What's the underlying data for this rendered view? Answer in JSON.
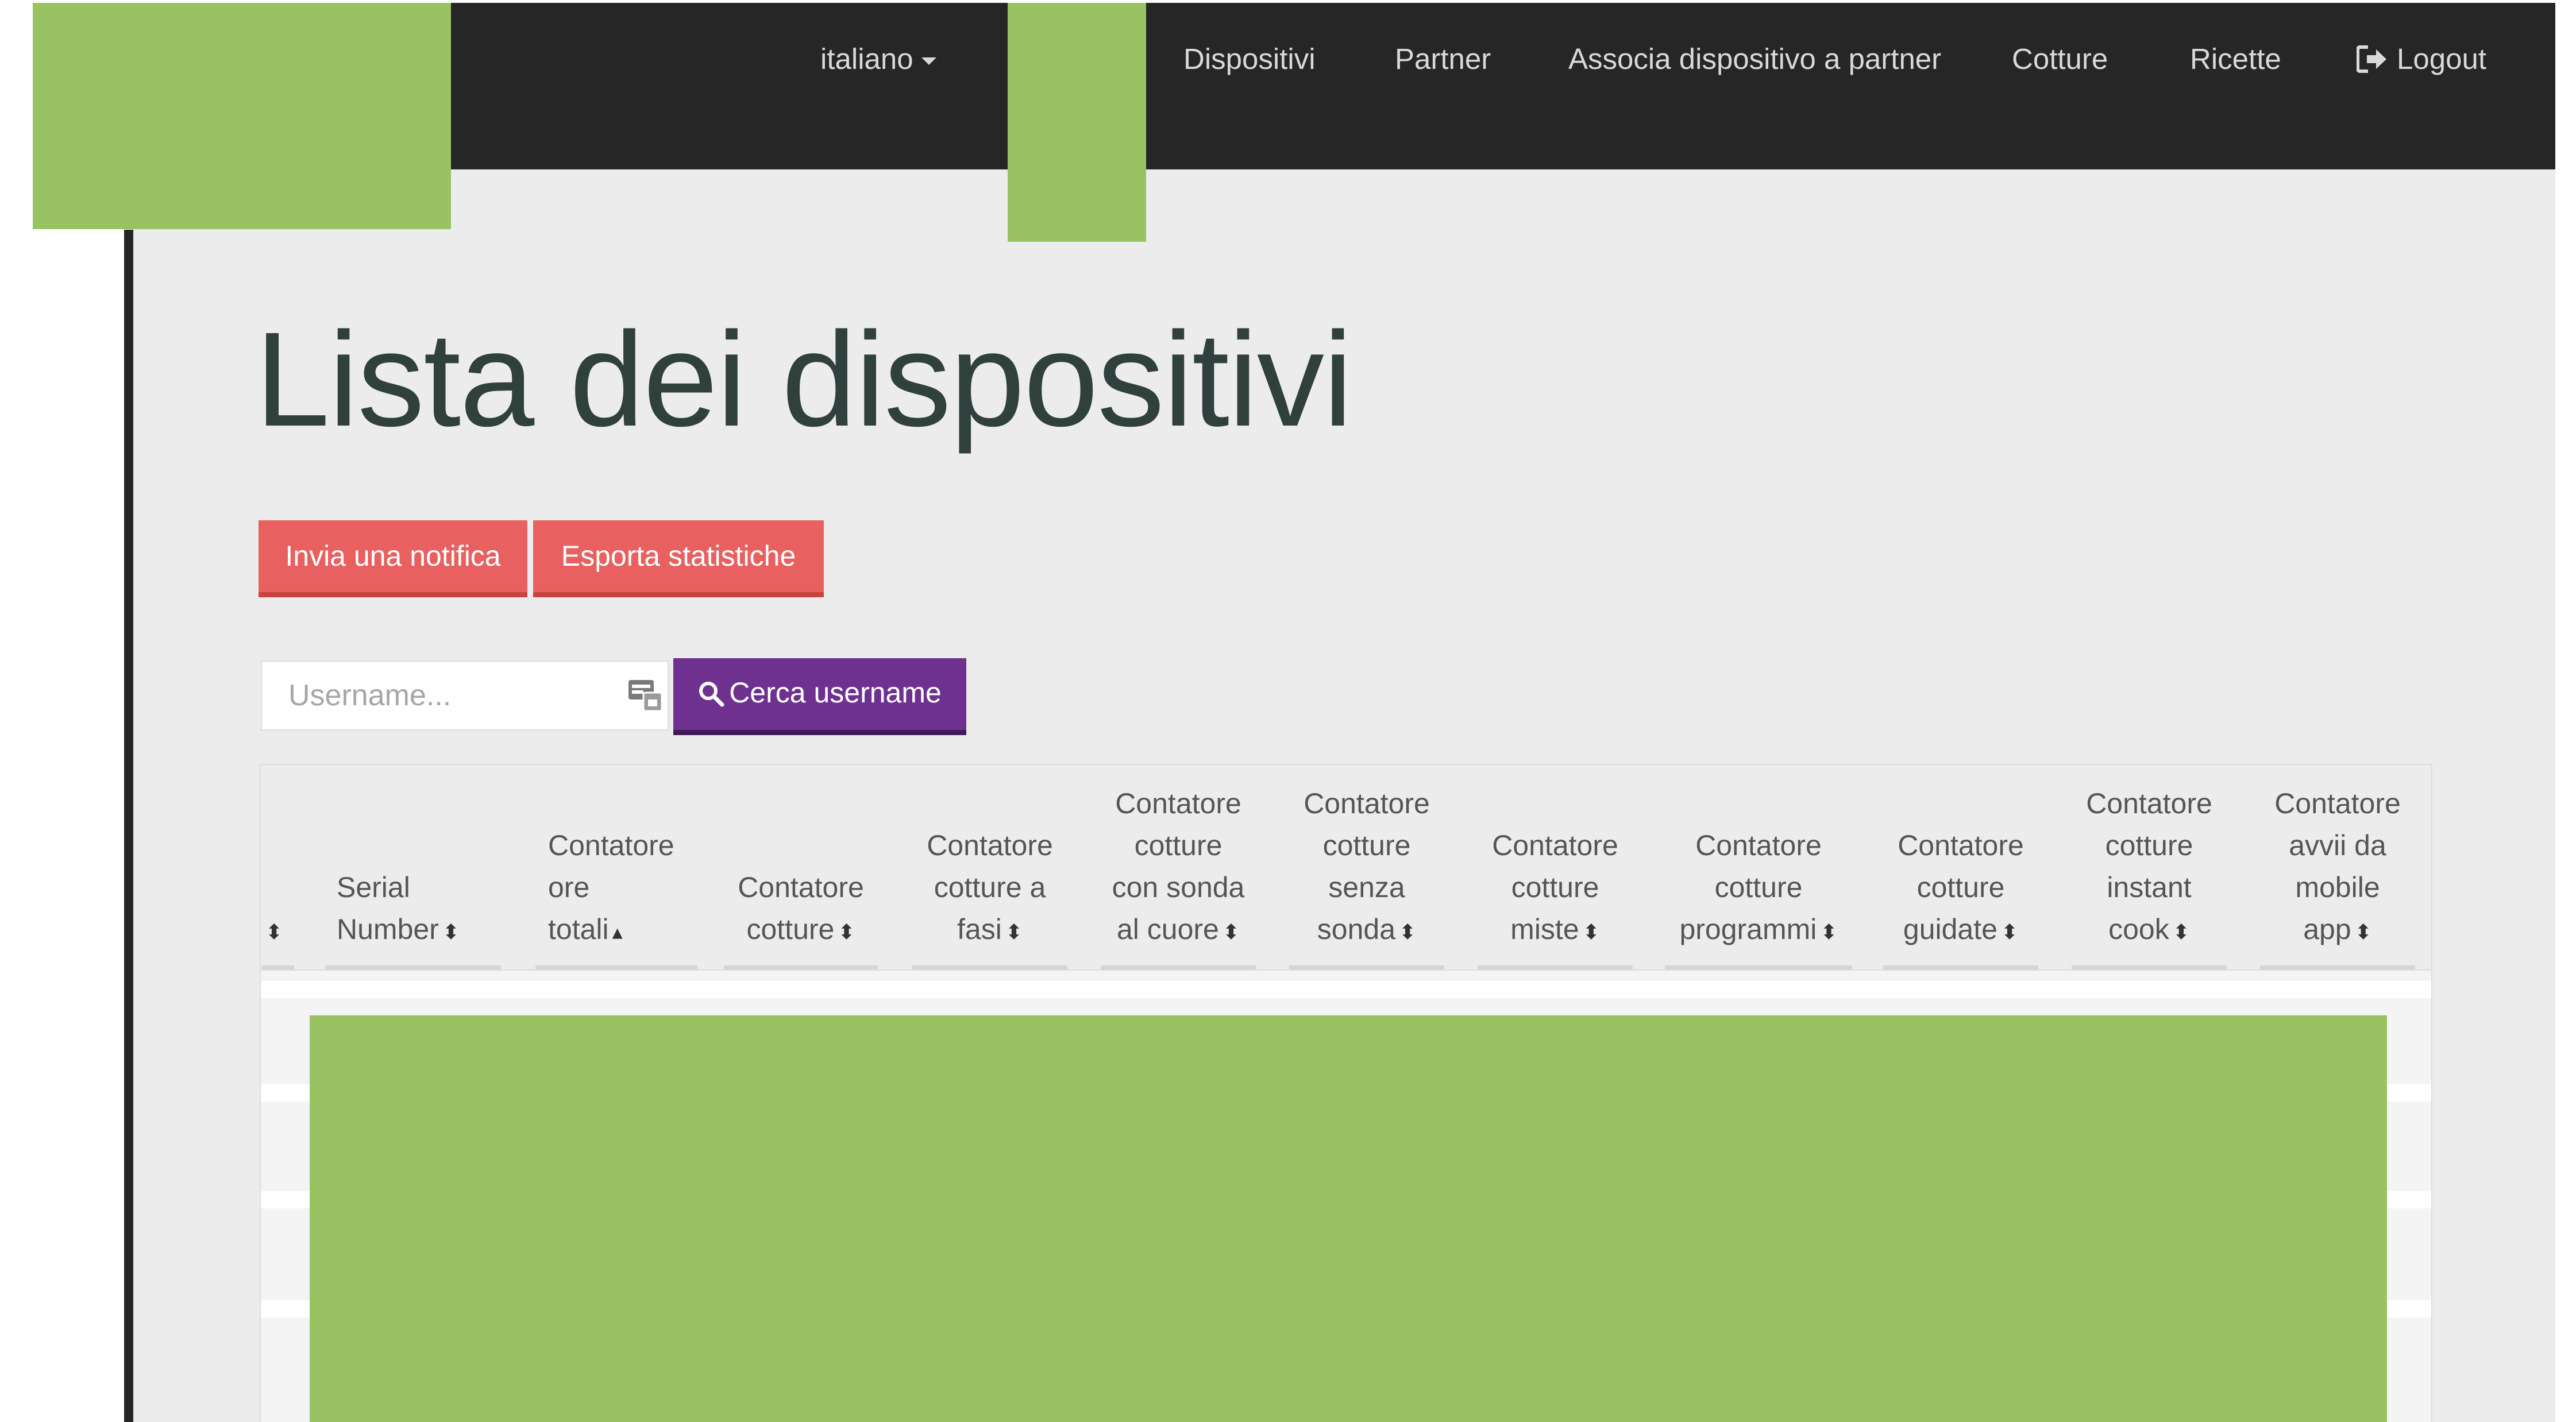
{
  "nav": {
    "language_label": "italiano",
    "items": [
      "Dispositivi",
      "Partner",
      "Associa dispositivo a partner",
      "Cotture",
      "Ricette"
    ],
    "logout_label": "Logout"
  },
  "page": {
    "title": "Lista dei dispositivi"
  },
  "actions": {
    "notify_label": "Invia una notifica",
    "export_label": "Esporta statistiche"
  },
  "search": {
    "placeholder": "Username...",
    "button_label": "Cerca username"
  },
  "table": {
    "columns": [
      "",
      "Serial\nNumber",
      "Contatore\nore\ntotali",
      "Contatore\ncotture",
      "Contatore\ncotture a\nfasi",
      "Contatore\ncotture\ncon sonda\nal cuore",
      "Contatore\ncotture\nsenza\nsonda",
      "Contatore\ncotture\nmiste",
      "Contatore\ncotture\nprogrammi",
      "Contatore\ncotture\nguidate",
      "Contatore\ncotture\ninstant\ncook",
      "Contatore\navvii da\nmobile\napp"
    ],
    "sort_indicators": [
      "⬍",
      "⬍",
      "▴",
      "⬍",
      "⬍",
      "⬍",
      "⬍",
      "⬍",
      "⬍",
      "⬍",
      "⬍",
      "⬍"
    ]
  },
  "colors": {
    "navbar": "#262626",
    "redaction": "#99c262",
    "danger": "#e8605f",
    "primary": "#6f3190",
    "title": "#30403d"
  }
}
